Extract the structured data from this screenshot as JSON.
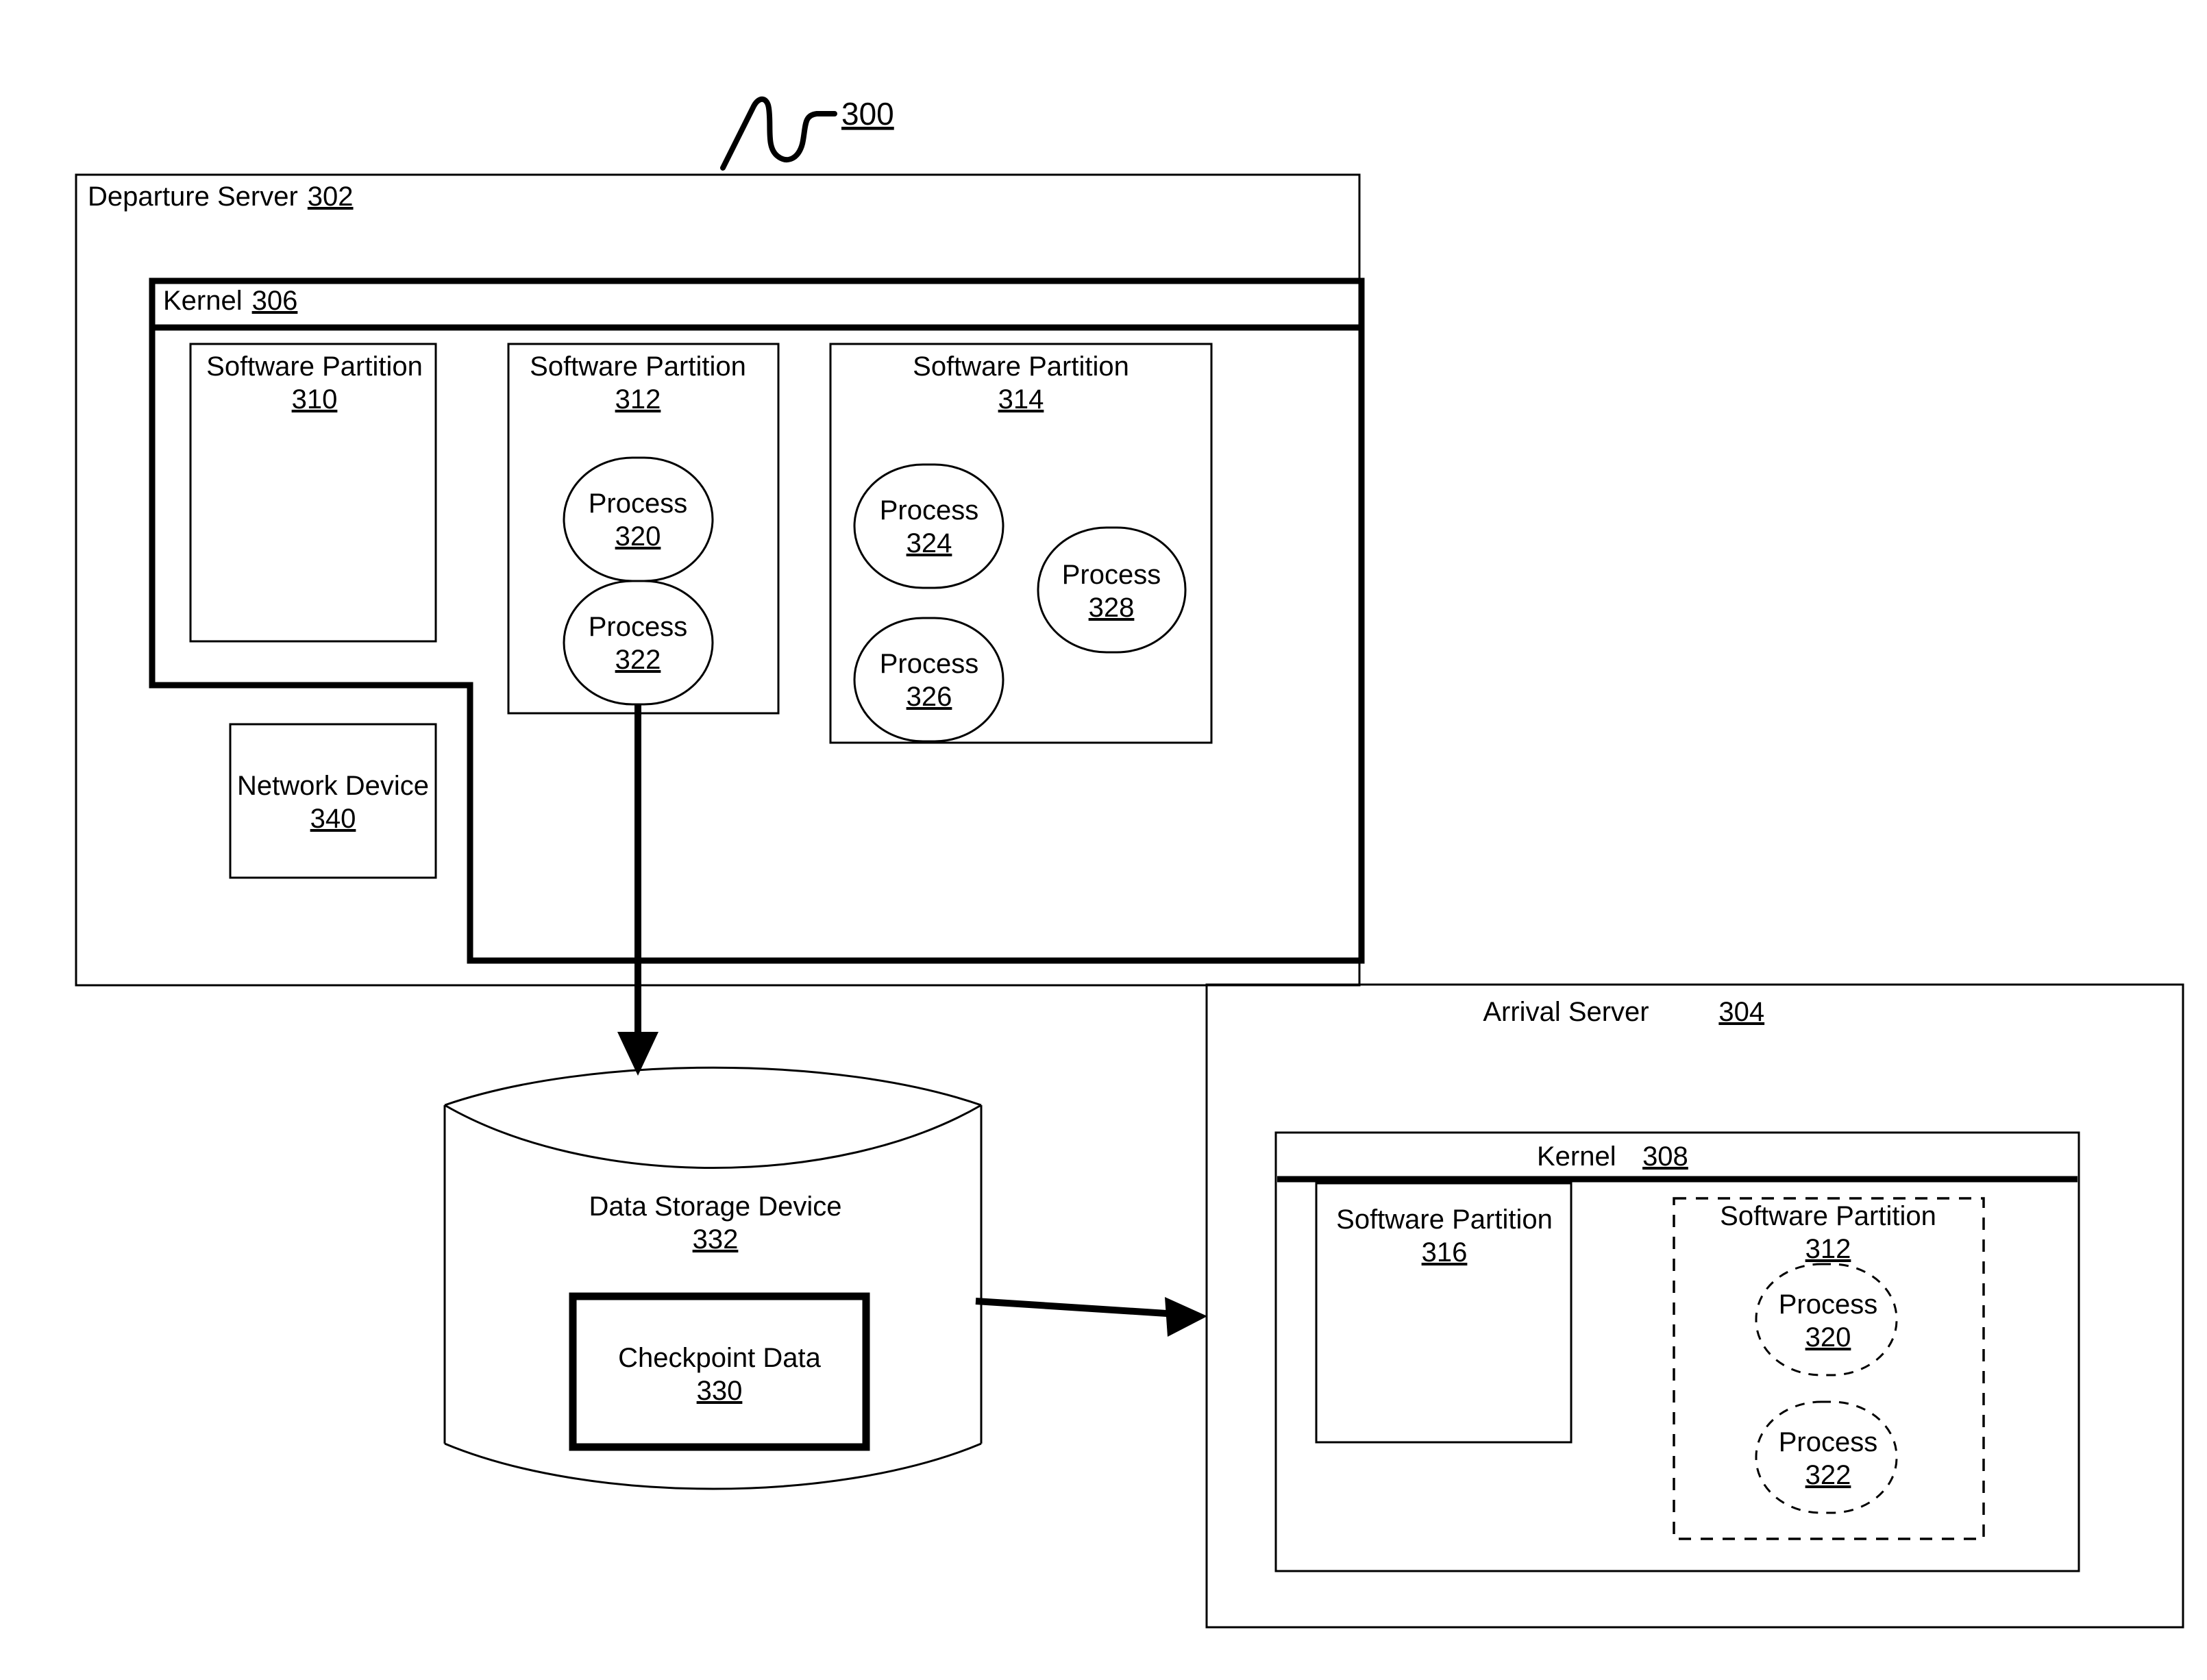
{
  "figure": {
    "number": "300",
    "leader_note": "curved-leader-line"
  },
  "departure_server": {
    "title": "Departure Server",
    "ref": "302",
    "kernel": {
      "title": "Kernel",
      "ref": "306",
      "partitions": [
        {
          "title": "Software Partition",
          "ref": "310",
          "processes": []
        },
        {
          "title": "Software Partition",
          "ref": "312",
          "processes": [
            {
              "title": "Process",
              "ref": "320"
            },
            {
              "title": "Process",
              "ref": "322"
            }
          ]
        },
        {
          "title": "Software Partition",
          "ref": "314",
          "processes": [
            {
              "title": "Process",
              "ref": "324"
            },
            {
              "title": "Process",
              "ref": "326"
            },
            {
              "title": "Process",
              "ref": "328"
            }
          ]
        }
      ]
    },
    "network_device": {
      "title": "Network Device",
      "ref": "340"
    }
  },
  "data_storage_device": {
    "title": "Data Storage Device",
    "ref": "332",
    "checkpoint_data": {
      "title": "Checkpoint Data",
      "ref": "330"
    }
  },
  "arrival_server": {
    "title": "Arrival Server",
    "ref": "304",
    "kernel": {
      "title": "Kernel",
      "ref": "308",
      "partitions": [
        {
          "title": "Software Partition",
          "ref": "316",
          "style": "solid",
          "processes": []
        },
        {
          "title": "Software Partition",
          "ref": "312",
          "style": "dashed",
          "processes": [
            {
              "title": "Process",
              "ref": "320"
            },
            {
              "title": "Process",
              "ref": "322"
            }
          ]
        }
      ]
    }
  },
  "connectors": [
    {
      "name": "checkpoint-write-arrow",
      "from": "process-322",
      "to": "data-storage-device"
    },
    {
      "name": "checkpoint-restore-arrow",
      "from": "data-storage-device",
      "to": "arrival-server"
    }
  ],
  "colors": {
    "stroke": "#000000",
    "background": "#ffffff"
  }
}
